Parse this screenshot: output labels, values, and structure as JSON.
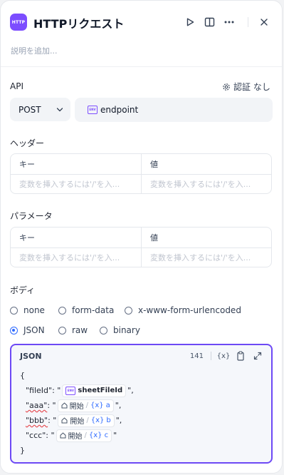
{
  "header": {
    "app_icon_text": "HTTP",
    "title": "HTTPリクエスト",
    "description_placeholder": "説明を追加..."
  },
  "api": {
    "label": "API",
    "auth_label": "認証 なし",
    "method": "POST",
    "endpoint_chip": "ENV",
    "endpoint": "endpoint"
  },
  "headers": {
    "label": "ヘッダー",
    "key_col": "キー",
    "value_col": "値",
    "key_placeholder": "変数を挿入するには'/'を入...",
    "value_placeholder": "変数を挿入するには'/'を入..."
  },
  "params": {
    "label": "パラメータ",
    "key_col": "キー",
    "value_col": "値",
    "key_placeholder": "変数を挿入するには'/'を入...",
    "value_placeholder": "変数を挿入するには'/'を入..."
  },
  "body": {
    "label": "ボディ",
    "options": [
      "none",
      "form-data",
      "x-www-form-urlencoded",
      "JSON",
      "raw",
      "binary"
    ],
    "selected": "JSON"
  },
  "editor": {
    "title": "JSON",
    "char_count": "141",
    "var_icon": "{x}",
    "lines": {
      "open": "{",
      "l1_prefix": "\"fileId\": \"",
      "l1_chip": "ENV",
      "l1_var": "sheetFileId",
      "l1_suffix": "\",",
      "l2_key": "\"aaa\"",
      "l2_mid": ": \"",
      "l2_node": "開始",
      "l2_var": "a",
      "l2_suffix": "\",",
      "l3_key": "\"bbb\"",
      "l3_mid": ": \"",
      "l3_node": "開始",
      "l3_var": "b",
      "l3_suffix": "\",",
      "l4_prefix": "\"ccc\": \"",
      "l4_node": "開始",
      "l4_var": "c",
      "l4_suffix": "\"",
      "close": "}"
    }
  },
  "colors": {
    "accent": "#7c4dff",
    "selection": "#2f6bff",
    "editor_border": "#6d49f5"
  }
}
